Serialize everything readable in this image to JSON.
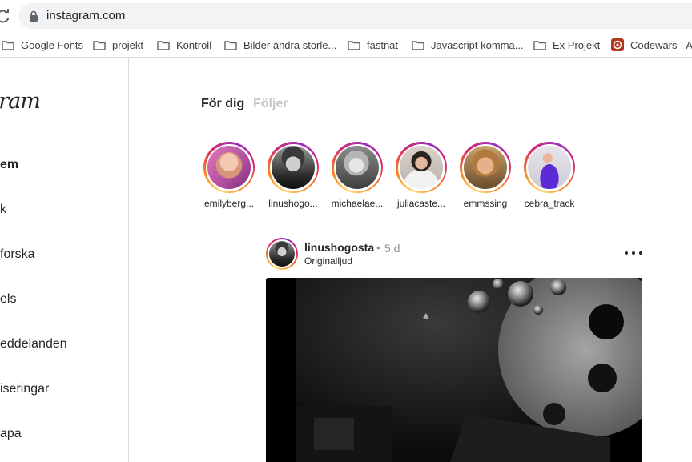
{
  "browser": {
    "url": "instagram.com",
    "bookmarks": [
      {
        "label": "Google Fonts",
        "icon": "folder-icon"
      },
      {
        "label": "projekt",
        "icon": "folder-icon"
      },
      {
        "label": "Kontroll",
        "icon": "folder-icon"
      },
      {
        "label": "Bilder ändra storle...",
        "icon": "folder-icon"
      },
      {
        "label": "fastnat",
        "icon": "folder-icon"
      },
      {
        "label": "Javascript komma...",
        "icon": "folder-icon"
      },
      {
        "label": "Ex Projekt",
        "icon": "folder-icon"
      },
      {
        "label": "Codewars - A",
        "icon": "codewars-icon"
      }
    ]
  },
  "sidebar": {
    "logo": "gram",
    "items": [
      {
        "label": "em"
      },
      {
        "label": "k"
      },
      {
        "label": "forska"
      },
      {
        "label": "els"
      },
      {
        "label": "eddelanden"
      },
      {
        "label": "iseringar"
      },
      {
        "label": "apa"
      }
    ]
  },
  "feed": {
    "tabs": [
      {
        "label": "För dig",
        "active": true
      },
      {
        "label": "Följer",
        "active": false
      }
    ],
    "stories": [
      {
        "name": "emilyberg..."
      },
      {
        "name": "linushogo..."
      },
      {
        "name": "michaelae..."
      },
      {
        "name": "juliacaste..."
      },
      {
        "name": "emmssing"
      },
      {
        "name": "cebra_track"
      }
    ],
    "post": {
      "username": "linushogosta",
      "separator": "•",
      "time": "5 d",
      "audio": "Originalljud"
    }
  },
  "colors": {
    "accent_gradient": [
      "#feda75",
      "#fa7e1e",
      "#d62976",
      "#962fbf"
    ],
    "text": "#262626",
    "muted": "#8e8e8e",
    "border": "#dbdbdb"
  }
}
